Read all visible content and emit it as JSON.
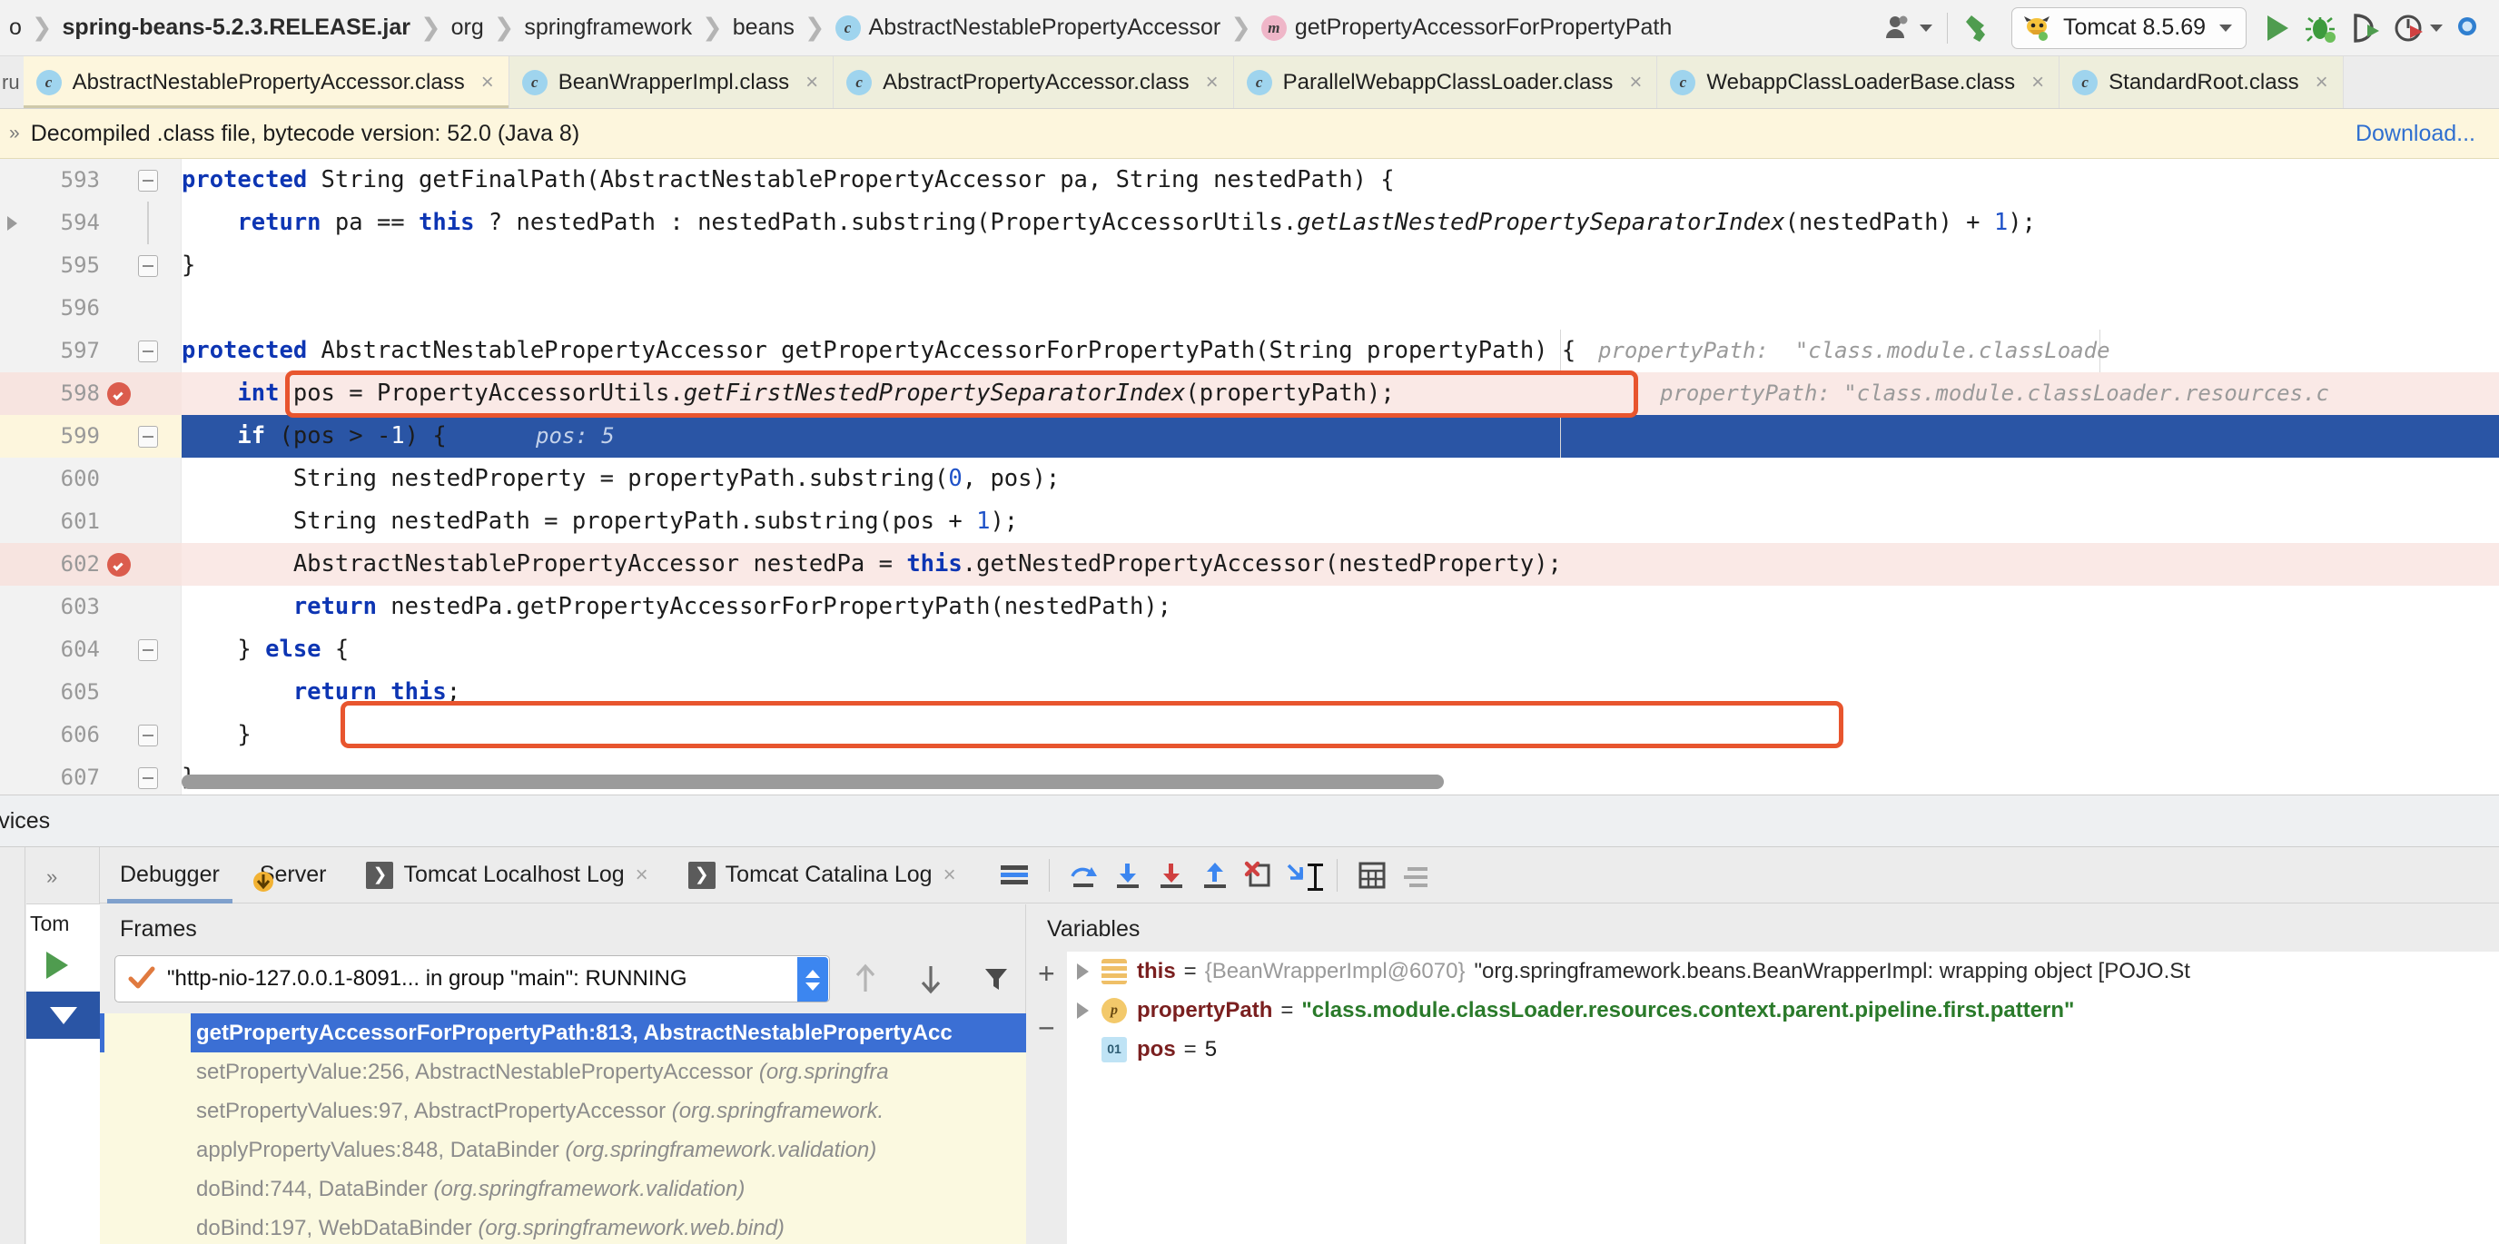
{
  "navbar": {
    "breadcrumbs": [
      {
        "label": "spring-beans-5.2.3.RELEASE.jar",
        "icon": "",
        "bold": true
      },
      {
        "label": "org",
        "icon": "",
        "bold": false
      },
      {
        "label": "springframework",
        "icon": "",
        "bold": false
      },
      {
        "label": "beans",
        "icon": "",
        "bold": false
      },
      {
        "label": "AbstractNestablePropertyAccessor",
        "icon": "class-icon",
        "badge": "c",
        "bold": false
      },
      {
        "label": "getPropertyAccessorForPropertyPath",
        "icon": "method-icon",
        "badge": "m",
        "bold": false
      }
    ],
    "leading_crumb": "o",
    "run_config": {
      "label": "Tomcat 8.5.69",
      "icon": "tomcat-icon"
    },
    "buttons": [
      {
        "name": "user-switch-button",
        "icon": "user-icon"
      },
      {
        "name": "build-button",
        "icon": "hammer-icon"
      },
      {
        "name": "run-button",
        "icon": "play-icon"
      },
      {
        "name": "debug-button",
        "icon": "bug-icon"
      },
      {
        "name": "run-with-coverage-button",
        "icon": "coverage-icon"
      },
      {
        "name": "profiler-button",
        "icon": "profiler-icon"
      }
    ]
  },
  "tabs": {
    "leading": "ru",
    "items": [
      {
        "label": "AbstractNestablePropertyAccessor.class",
        "badge": "c",
        "active": true
      },
      {
        "label": "BeanWrapperImpl.class",
        "badge": "c",
        "active": false
      },
      {
        "label": "AbstractPropertyAccessor.class",
        "badge": "c",
        "active": false
      },
      {
        "label": "ParallelWebappClassLoader.class",
        "badge": "c",
        "active": false
      },
      {
        "label": "WebappClassLoaderBase.class",
        "badge": "c",
        "active": false
      },
      {
        "label": "StandardRoot.class",
        "badge": "c",
        "active": false
      }
    ],
    "close_glyph": "×"
  },
  "banner": {
    "chevron": "»",
    "text": "Decompiled .class file, bytecode version: 52.0 (Java 8)",
    "link": "Download..."
  },
  "editor": {
    "lines": [
      {
        "num": "593",
        "breakpoint": false,
        "fold": "collapse",
        "foldline": false,
        "arrow": false,
        "state": "normal",
        "indent": 0,
        "segments": [
          {
            "t": "protected ",
            "c": "kw"
          },
          {
            "t": "String getFinalPath(AbstractNestablePropertyAccessor pa, String nestedPath) {",
            "c": ""
          }
        ],
        "hint": ""
      },
      {
        "num": "594",
        "breakpoint": false,
        "fold": "",
        "foldline": true,
        "arrow": true,
        "state": "normal",
        "indent": 0,
        "segments": [
          {
            "t": "    return ",
            "c": "kw"
          },
          {
            "t": "pa == ",
            "c": ""
          },
          {
            "t": "this",
            "c": "kw"
          },
          {
            "t": " ? nestedPath : nestedPath.substring(PropertyAccessorUtils.",
            "c": ""
          },
          {
            "t": "getLastNestedPropertySeparatorIndex",
            "c": "ital"
          },
          {
            "t": "(nestedPath) + ",
            "c": ""
          },
          {
            "t": "1",
            "c": "num"
          },
          {
            "t": ");",
            "c": ""
          }
        ],
        "hint": ""
      },
      {
        "num": "595",
        "breakpoint": false,
        "fold": "collapse",
        "foldline": false,
        "arrow": false,
        "state": "normal",
        "indent": 0,
        "segments": [
          {
            "t": "}",
            "c": ""
          }
        ],
        "hint": ""
      },
      {
        "num": "596",
        "breakpoint": false,
        "fold": "",
        "foldline": false,
        "arrow": false,
        "state": "normal",
        "indent": 0,
        "segments": [],
        "hint": ""
      },
      {
        "num": "597",
        "breakpoint": false,
        "fold": "collapse",
        "foldline": false,
        "arrow": false,
        "state": "normal",
        "indent": 0,
        "segments": [
          {
            "t": "protected ",
            "c": "kw"
          },
          {
            "t": "AbstractNestablePropertyAccessor getPropertyAccessorForPropertyPath(String propertyPath) {",
            "c": ""
          }
        ],
        "hint": "propertyPath:  \"class.module.classLoade"
      },
      {
        "num": "598",
        "breakpoint": true,
        "fold": "",
        "foldline": false,
        "arrow": false,
        "state": "breakpoint",
        "indent": 0,
        "segments": [
          {
            "t": "    int ",
            "c": "kw"
          },
          {
            "t": "pos = PropertyAccessorUtils.",
            "c": ""
          },
          {
            "t": "getFirstNestedPropertySeparatorIndex",
            "c": "ital"
          },
          {
            "t": "(propertyPath);",
            "c": ""
          }
        ],
        "hint": "propertyPath: \"class.module.classLoader.resources.c"
      },
      {
        "num": "599",
        "breakpoint": false,
        "fold": "collapse",
        "foldline": false,
        "arrow": false,
        "state": "selected",
        "indent": 0,
        "segments": [
          {
            "t": "    if ",
            "c": "kw"
          },
          {
            "t": "(pos > -",
            "c": ""
          },
          {
            "t": "1",
            "c": "num"
          },
          {
            "t": ") {",
            "c": ""
          }
        ],
        "hint": "pos: 5"
      },
      {
        "num": "600",
        "breakpoint": false,
        "fold": "",
        "foldline": false,
        "arrow": false,
        "state": "normal",
        "indent": 0,
        "segments": [
          {
            "t": "        String nestedProperty = propertyPath.substring(",
            "c": ""
          },
          {
            "t": "0",
            "c": "num"
          },
          {
            "t": ", pos);",
            "c": ""
          }
        ],
        "hint": ""
      },
      {
        "num": "601",
        "breakpoint": false,
        "fold": "",
        "foldline": false,
        "arrow": false,
        "state": "normal",
        "indent": 0,
        "segments": [
          {
            "t": "        String nestedPath = propertyPath.substring(pos + ",
            "c": ""
          },
          {
            "t": "1",
            "c": "num"
          },
          {
            "t": ");",
            "c": ""
          }
        ],
        "hint": ""
      },
      {
        "num": "602",
        "breakpoint": true,
        "fold": "",
        "foldline": false,
        "arrow": false,
        "state": "breakpoint",
        "indent": 0,
        "segments": [
          {
            "t": "        AbstractNestablePropertyAccessor nestedPa = ",
            "c": ""
          },
          {
            "t": "this",
            "c": "kw"
          },
          {
            "t": ".getNestedPropertyAccessor(nestedProperty);",
            "c": ""
          }
        ],
        "hint": ""
      },
      {
        "num": "603",
        "breakpoint": false,
        "fold": "",
        "foldline": false,
        "arrow": false,
        "state": "normal",
        "indent": 0,
        "segments": [
          {
            "t": "        return ",
            "c": "kw"
          },
          {
            "t": "nestedPa.getPropertyAccessorForPropertyPath(nestedPath);",
            "c": ""
          }
        ],
        "hint": ""
      },
      {
        "num": "604",
        "breakpoint": false,
        "fold": "collapse",
        "foldline": false,
        "arrow": false,
        "state": "normal",
        "indent": 0,
        "segments": [
          {
            "t": "    } ",
            "c": ""
          },
          {
            "t": "else",
            "c": "kw"
          },
          {
            "t": " {",
            "c": ""
          }
        ],
        "hint": ""
      },
      {
        "num": "605",
        "breakpoint": false,
        "fold": "",
        "foldline": false,
        "arrow": false,
        "state": "normal",
        "indent": 0,
        "segments": [
          {
            "t": "        return ",
            "c": "kw"
          },
          {
            "t": "this",
            "c": "kw"
          },
          {
            "t": ";",
            "c": ""
          }
        ],
        "hint": ""
      },
      {
        "num": "606",
        "breakpoint": false,
        "fold": "collapse",
        "foldline": false,
        "arrow": false,
        "state": "normal",
        "indent": 0,
        "segments": [
          {
            "t": "    }",
            "c": ""
          }
        ],
        "hint": ""
      },
      {
        "num": "607",
        "breakpoint": false,
        "fold": "collapse",
        "foldline": false,
        "arrow": false,
        "state": "normal",
        "indent": 0,
        "segments": [
          {
            "t": "}",
            "c": ""
          }
        ],
        "hint": ""
      }
    ]
  },
  "services": {
    "label": "ervices"
  },
  "run_column": {
    "name": "Tom",
    "tomcat_label": "Tom"
  },
  "debugger": {
    "expand_chevron": "»",
    "tabs": [
      {
        "label": "Debugger",
        "active": true,
        "closable": false,
        "icon": ""
      },
      {
        "label": "Server",
        "active": false,
        "closable": false,
        "icon": ""
      },
      {
        "label": "Tomcat Localhost Log",
        "active": false,
        "closable": true,
        "icon": "console-icon"
      },
      {
        "label": "Tomcat Catalina Log",
        "active": false,
        "closable": true,
        "icon": "console-icon"
      }
    ],
    "toolbar": [
      {
        "name": "show-execution-point-button",
        "icon": "execution-point-icon"
      },
      {
        "name": "step-over-button",
        "icon": "step-over-icon"
      },
      {
        "name": "step-into-button",
        "icon": "step-into-icon"
      },
      {
        "name": "force-step-into-button",
        "icon": "force-step-into-icon"
      },
      {
        "name": "step-out-button",
        "icon": "step-out-icon"
      },
      {
        "name": "drop-frame-button",
        "icon": "drop-frame-icon"
      },
      {
        "name": "run-to-cursor-button",
        "icon": "run-to-cursor-icon"
      },
      {
        "name": "evaluate-expression-button",
        "icon": "calculator-icon"
      },
      {
        "name": "settings-button",
        "icon": "settings-lines-icon"
      }
    ],
    "frames_panel": {
      "title": "Frames",
      "thread_selector": "\"http-nio-127.0.0.1-8091... in group \"main\": RUNNING",
      "frames": [
        {
          "method": "getPropertyAccessorForPropertyPath:813, AbstractNestablePropertyAcc",
          "pkg": "",
          "selected": true
        },
        {
          "method": "setPropertyValue:256, AbstractNestablePropertyAccessor ",
          "pkg": "(org.springfra",
          "selected": false
        },
        {
          "method": "setPropertyValues:97, AbstractPropertyAccessor ",
          "pkg": "(org.springframework.",
          "selected": false
        },
        {
          "method": "applyPropertyValues:848, DataBinder ",
          "pkg": "(org.springframework.validation)",
          "selected": false
        },
        {
          "method": "doBind:744, DataBinder ",
          "pkg": "(org.springframework.validation)",
          "selected": false
        },
        {
          "method": "doBind:197, WebDataBinder ",
          "pkg": "(org.springframework.web.bind)",
          "selected": false
        }
      ]
    },
    "variables_panel": {
      "title": "Variables",
      "rows": [
        {
          "expandable": true,
          "icon": "object-icon",
          "icon_glyph": "",
          "name": "this",
          "eq": "=",
          "ref": "{BeanWrapperImpl@6070}",
          "value": "\"org.springframework.beans.BeanWrapperImpl: wrapping object [POJO.St",
          "value_style": "plain"
        },
        {
          "expandable": true,
          "icon": "parameter-icon",
          "icon_glyph": "p",
          "name": "propertyPath",
          "eq": "=",
          "ref": "",
          "value": "\"class.module.classLoader.resources.context.parent.pipeline.first.pattern\"",
          "value_style": "string-green"
        },
        {
          "expandable": false,
          "icon": "primitive-icon",
          "icon_glyph": "01",
          "name": "pos",
          "eq": "=",
          "ref": "",
          "value": "5",
          "value_style": "number"
        }
      ]
    }
  },
  "colors": {
    "selection_blue": "#2a55a5",
    "frame_selected_blue": "#3b6fd4",
    "breakpoint_red": "#db5c4d",
    "annotation_red": "#e8552e",
    "banner_yellow": "#fdf6dd",
    "frames_cream": "#fbf9e0",
    "string_green": "#2a7a2a",
    "keyword_blue": "#0d35b3"
  }
}
